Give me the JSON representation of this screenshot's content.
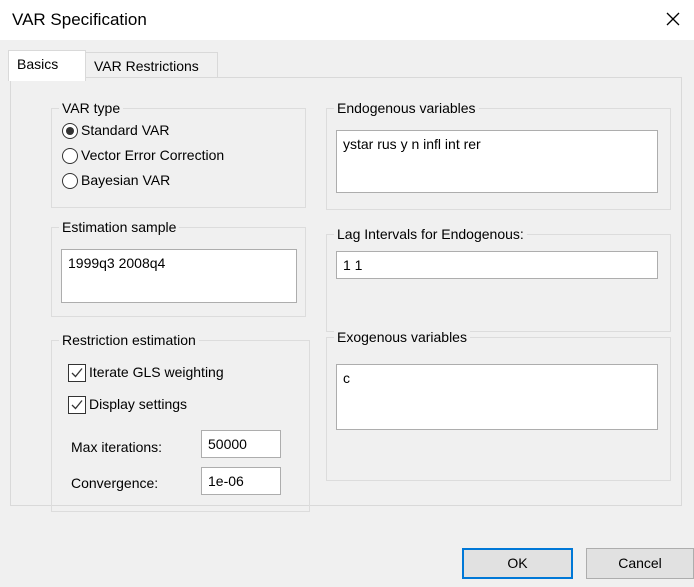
{
  "window": {
    "title": "VAR Specification"
  },
  "tabs": [
    {
      "label": "Basics",
      "active": true
    },
    {
      "label": "VAR Restrictions",
      "active": false
    }
  ],
  "var_type": {
    "label": "VAR type",
    "options": [
      {
        "label": "Standard VAR",
        "selected": true
      },
      {
        "label": "Vector Error Correction",
        "selected": false
      },
      {
        "label": "Bayesian VAR",
        "selected": false
      }
    ]
  },
  "estimation_sample": {
    "label": "Estimation sample",
    "value": "1999q3 2008q4"
  },
  "restriction_estimation": {
    "label": "Restriction estimation",
    "iterate_gls": {
      "label": "Iterate GLS weighting",
      "checked": true
    },
    "display_settings": {
      "label": "Display settings",
      "checked": true
    },
    "max_iterations": {
      "label": "Max iterations:",
      "value": "50000"
    },
    "convergence": {
      "label": "Convergence:",
      "value": "1e-06"
    }
  },
  "endogenous": {
    "label": "Endogenous variables",
    "value": "ystar rus y n infl int rer"
  },
  "lag_intervals": {
    "label": "Lag Intervals for Endogenous:",
    "value": "1 1"
  },
  "exogenous": {
    "label": "Exogenous variables",
    "value": "c"
  },
  "buttons": {
    "ok": "OK",
    "cancel": "Cancel"
  },
  "colors": {
    "accent": "#0078d7",
    "dialog_bg": "#f0f0f0",
    "panel_border": "#d9d9d9"
  }
}
